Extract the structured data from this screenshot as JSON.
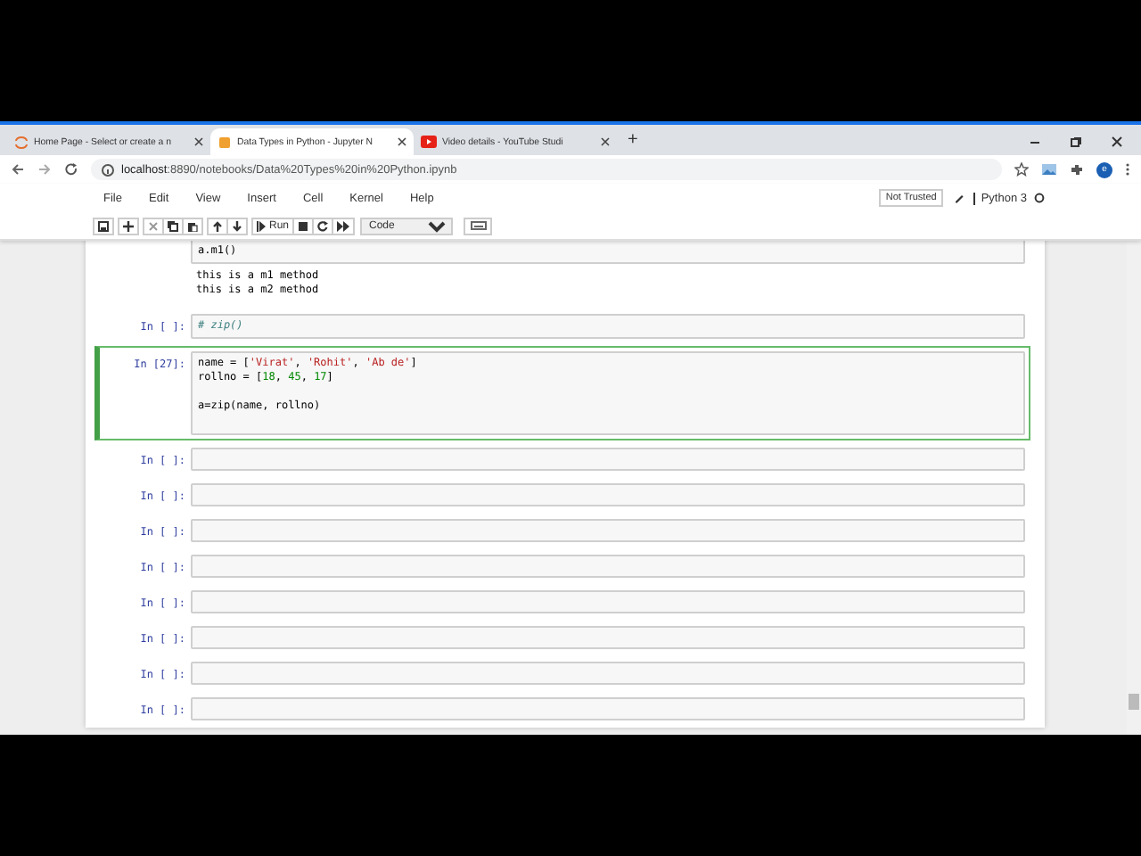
{
  "browser": {
    "tabs": [
      {
        "title": "Home Page - Select or create a n",
        "selected": false,
        "kind": "jupyter"
      },
      {
        "title": "Data Types in Python - Jupyter N",
        "selected": true,
        "kind": "notebook"
      },
      {
        "title": "Video details - YouTube Studi",
        "selected": false,
        "kind": "video"
      }
    ],
    "new_tab": "+",
    "address": {
      "host": "localhost",
      "path": ":8890/notebooks/Data%20Types%20in%20Python.ipynb"
    },
    "profile": "e"
  },
  "menu": [
    "File",
    "Edit",
    "View",
    "Insert",
    "Cell",
    "Kernel",
    "Help"
  ],
  "toolbar": {
    "run": "Run",
    "cell_type": "Code"
  },
  "trust": "Not Trusted",
  "kernel": "Python 3",
  "cells": [
    {
      "selected": false,
      "lines": [
        {
          "tokens": [
            {
              "t": "a.m1()",
              "kind": "plain"
            }
          ]
        }
      ],
      "output": [
        "this is a m1 method",
        "this is a m2 method"
      ]
    },
    {
      "prompt": "In [ ]:",
      "selected": false,
      "lines": [
        {
          "tokens": [
            {
              "t": "# zip()",
              "kind": "comment"
            }
          ]
        }
      ]
    },
    {
      "prompt": "In [27]:",
      "selected": true,
      "lines": [
        {
          "tokens": [
            {
              "t": "name = [",
              "kind": "plain"
            },
            {
              "t": "'Virat'",
              "kind": "string"
            },
            {
              "t": ", ",
              "kind": "plain"
            },
            {
              "t": "'Rohit'",
              "kind": "string"
            },
            {
              "t": ", ",
              "kind": "plain"
            },
            {
              "t": "'Ab de'",
              "kind": "string"
            },
            {
              "t": "]",
              "kind": "plain"
            }
          ]
        },
        {
          "tokens": [
            {
              "t": "rollno = [",
              "kind": "plain"
            },
            {
              "t": "18",
              "kind": "number"
            },
            {
              "t": ", ",
              "kind": "plain"
            },
            {
              "t": "45",
              "kind": "number"
            },
            {
              "t": ", ",
              "kind": "plain"
            },
            {
              "t": "17",
              "kind": "number"
            },
            {
              "t": "]",
              "kind": "plain"
            }
          ]
        },
        {
          "blank": true
        },
        {
          "tokens": [
            {
              "t": "a=zip(name, rollno)",
              "kind": "plain"
            }
          ]
        }
      ]
    },
    {
      "prompt": "In [ ]:",
      "selected": false
    },
    {
      "prompt": "In [ ]:",
      "selected": false
    },
    {
      "prompt": "In [ ]:",
      "selected": false
    },
    {
      "prompt": "In [ ]:",
      "selected": false
    },
    {
      "prompt": "In [ ]:",
      "selected": false
    },
    {
      "prompt": "In [ ]:",
      "selected": false
    },
    {
      "prompt": "In [ ]:",
      "selected": false
    },
    {
      "prompt": "In [ ]:",
      "selected": false
    }
  ]
}
